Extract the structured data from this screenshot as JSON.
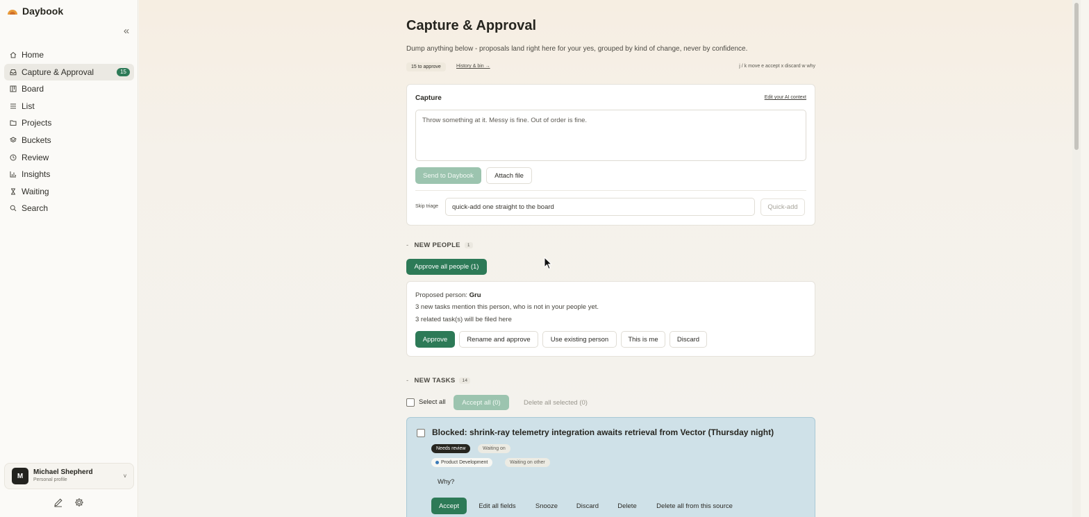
{
  "app": {
    "name": "Daybook"
  },
  "sidebar": {
    "items": [
      {
        "label": "Home",
        "icon": "home-icon"
      },
      {
        "label": "Capture & Approval",
        "icon": "inbox-icon",
        "badge": "15",
        "active": true
      },
      {
        "label": "Board",
        "icon": "board-icon"
      },
      {
        "label": "List",
        "icon": "list-icon"
      },
      {
        "label": "Projects",
        "icon": "folder-icon"
      },
      {
        "label": "Buckets",
        "icon": "layers-icon"
      },
      {
        "label": "Review",
        "icon": "history-icon"
      },
      {
        "label": "Insights",
        "icon": "bar-chart-icon"
      },
      {
        "label": "Waiting",
        "icon": "hourglass-icon"
      },
      {
        "label": "Search",
        "icon": "search-icon"
      }
    ],
    "profile": {
      "initial": "M",
      "name": "Michael Shepherd",
      "subtitle": "Personal profile",
      "chevron": "v"
    }
  },
  "header": {
    "title": "Capture & Approval",
    "subtitle": "Dump anything below - proposals land right here for your yes, grouped by kind of change, never by confidence.",
    "count_pill": "15 to approve",
    "history_link": "History & bin →",
    "shortcuts": "j / k move  e accept  x discard  w why"
  },
  "capture": {
    "title": "Capture",
    "ai_link": "Edit your AI context",
    "placeholder": "Throw something at it. Messy is fine. Out of order is fine.",
    "send_label": "Send to Daybook",
    "attach_label": "Attach file",
    "skip_label": "Skip triage",
    "quick_placeholder": "quick-add one straight to the board",
    "quick_label": "Quick-add"
  },
  "people_section": {
    "label": "NEW PEOPLE",
    "count": "1",
    "approve_all": "Approve all people (1)",
    "card": {
      "proposed_prefix": "Proposed person:",
      "name": "Gru",
      "line2": "3 new tasks mention this person, who is not in your people yet.",
      "line3": "3 related task(s) will be filed here",
      "actions": {
        "approve": "Approve",
        "rename": "Rename and approve",
        "existing": "Use existing person",
        "me": "This is me",
        "discard": "Discard"
      }
    }
  },
  "tasks_section": {
    "label": "NEW TASKS",
    "count": "14",
    "select_all": "Select all",
    "accept_all": "Accept all (0)",
    "delete_selected": "Delete all selected (0)",
    "task": {
      "title": "Blocked: shrink-ray telemetry integration awaits retrieval from Vector (Thursday night)",
      "tags": {
        "review": "Needs review",
        "waiting": "Waiting on",
        "project": "Product Development",
        "waiting_other": "Waiting on other"
      },
      "project_color": "#3a7ab8",
      "why": "Why?",
      "actions": {
        "accept": "Accept",
        "edit": "Edit all fields",
        "snooze": "Snooze",
        "discard": "Discard",
        "delete": "Delete",
        "delete_source": "Delete all from this source"
      }
    }
  },
  "colors": {
    "accent": "#2d7a57",
    "accent_disabled": "#9cc4af",
    "task_highlight": "#cfe1e8"
  }
}
